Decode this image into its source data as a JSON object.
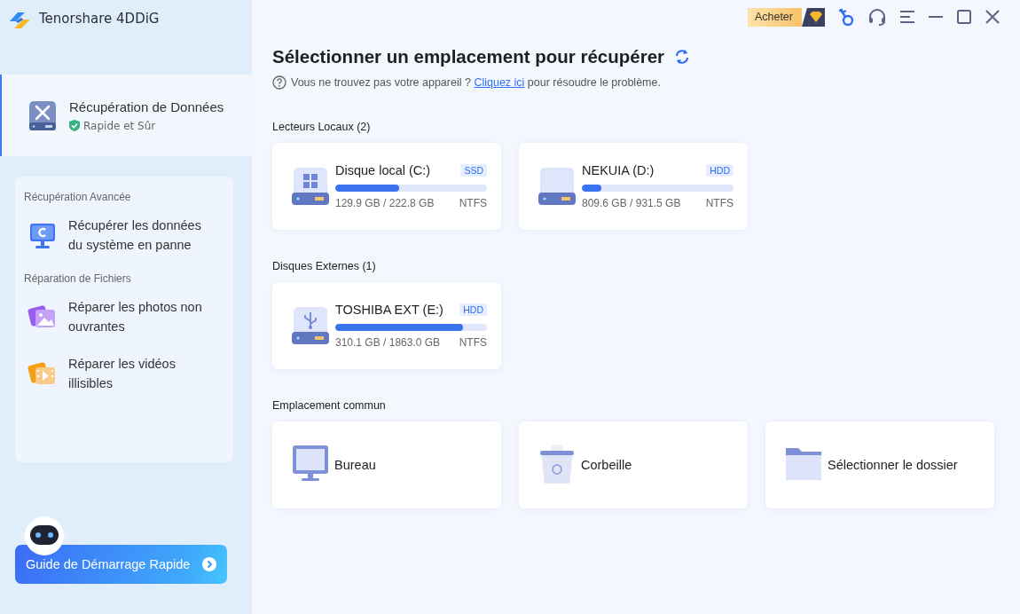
{
  "app": {
    "title": "Tenorshare 4DDiG"
  },
  "toolbar": {
    "buy_button": "Acheter"
  },
  "sidebar": {
    "main_item": {
      "title": "Récupération de Données",
      "subtitle": "Rapide et Sûr",
      "selected": true
    },
    "sections": [
      {
        "heading": "Récupération Avancée",
        "items": [
          {
            "label": "Récupérer les données du système en panne",
            "kind": "system",
            "selected": false
          }
        ]
      },
      {
        "heading": "Réparation de Fichiers",
        "items": [
          {
            "label": "Réparer les photos non ouvrantes",
            "kind": "photo",
            "selected": false
          },
          {
            "label": "Réparer les vidéos illisibles",
            "kind": "video",
            "selected": false
          }
        ]
      }
    ],
    "guide_button": "Guide de Démarrage Rapide"
  },
  "main": {
    "title": "Sélectionner un emplacement pour récupérer",
    "help": {
      "before": "Vous ne trouvez pas votre appareil ?",
      "link": "Cliquez ici",
      "after": "pour résoudre le problème."
    },
    "groups": [
      {
        "heading": "Lecteurs Locaux (2)",
        "drives": [
          {
            "name": "Disque local (C:)",
            "type": "SSD",
            "kind": "windows",
            "level": 0.42,
            "usage": "129.9 GB / 222.8 GB",
            "fs": "NTFS"
          },
          {
            "name": "NEKUIA (D:)",
            "type": "HDD",
            "kind": "plain",
            "level": 0.13,
            "usage": "809.6 GB / 931.5 GB",
            "fs": "NTFS"
          }
        ]
      },
      {
        "heading": "Disques Externes (1)",
        "drives": [
          {
            "name": "TOSHIBA EXT (E:)",
            "type": "HDD",
            "kind": "usb",
            "level": 0.84,
            "usage": "310.1 GB / 1863.0 GB",
            "fs": "NTFS"
          }
        ]
      }
    ],
    "common": {
      "heading": "Emplacement commun",
      "items": [
        {
          "label": "Bureau",
          "kind": "desktop"
        },
        {
          "label": "Corbeille",
          "kind": "trash"
        },
        {
          "label": "Sélectionner le dossier",
          "kind": "folder"
        }
      ]
    }
  }
}
